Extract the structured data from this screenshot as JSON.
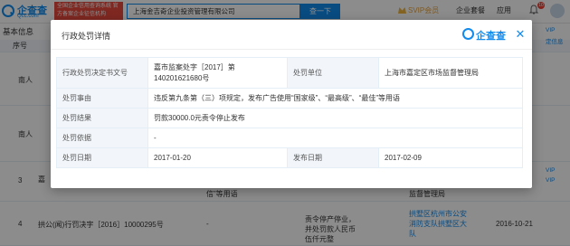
{
  "header": {
    "logo_name": "企查查",
    "logo_domain": "Qcc.com",
    "badge_text": "全国企业信用查询系统 官方备案企业征信机构",
    "search_value": "上海金吉奇企业投资管理有限公司",
    "search_button": "查一下",
    "nav_svip": "SVIP会员",
    "nav_enterprise": "企业套餐",
    "nav_app": "应用",
    "notification_count": "10"
  },
  "background": {
    "section_title": "基本信息",
    "column_seq": "序号",
    "right_tags": [
      "VIP",
      "定信息",
      "VIP",
      "VIP"
    ],
    "rows": [
      {
        "num": "",
        "col1": "南人",
        "col2": "",
        "col3": ""
      },
      {
        "num": "",
        "col1": "南人",
        "col2": "",
        "col3": ""
      },
      {
        "num": "3",
        "col1": "嘉",
        "col2": "信”等用语",
        "col3": "监督管理局"
      },
      {
        "num": "4",
        "col1": "拱公(闻)行罚决字［2016］10000295号",
        "col2": "-",
        "col3": "责令停产停业，并处罚款人民币伍仟元整",
        "col4": "拱墅区杭州市公安消防支队拱墅区大队",
        "col5": "2016-10-21"
      }
    ]
  },
  "modal": {
    "title": "行政处罚详情",
    "logo_text": "企查查",
    "rows": [
      {
        "label1": "行政处罚决定书文号",
        "value1": "嘉市监案处字［2017］第140201621680号",
        "label2": "处罚单位",
        "value2": "上海市嘉定区市场监督管理局"
      },
      {
        "label": "处罚事由",
        "value": "违反第九条第（三）项规定，发布广告使用“国家级”、“最高级”、“最佳”等用语"
      },
      {
        "label": "处罚结果",
        "value": "罚款30000.0元责令停止发布"
      },
      {
        "label": "处罚依据",
        "value": "-"
      },
      {
        "label1": "处罚日期",
        "value1": "2017-01-20",
        "label2": "发布日期",
        "value2": "2017-02-09"
      }
    ]
  }
}
